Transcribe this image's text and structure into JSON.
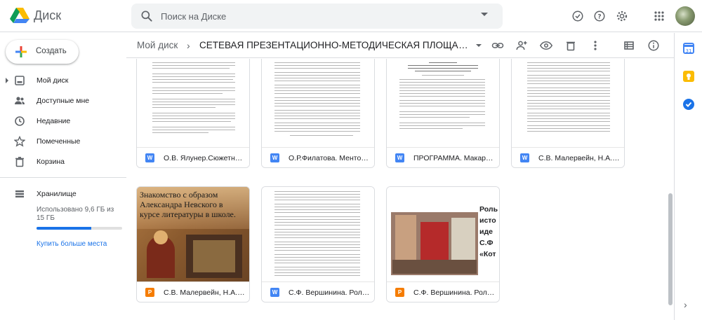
{
  "app": {
    "title": "Диск"
  },
  "search": {
    "placeholder": "Поиск на Диске"
  },
  "sidebar": {
    "new_label": "Создать",
    "items": [
      {
        "label": "Мой диск"
      },
      {
        "label": "Доступные мне"
      },
      {
        "label": "Недавние"
      },
      {
        "label": "Помеченные"
      },
      {
        "label": "Корзина"
      }
    ],
    "storage_label": "Хранилище",
    "storage_used": "Использовано 9,6 ГБ из 15 ГБ",
    "storage_fraction": 0.64,
    "buy_label": "Купить больше места"
  },
  "breadcrumb": {
    "root": "Мой диск",
    "folder": "СЕТЕВАЯ ПРЕЗЕНТАЦИОННО-МЕТОДИЧЕСКАЯ ПЛОЩАДКА ..."
  },
  "files": [
    {
      "name": "О.В. Ялунер.Сюжетно-р...",
      "type": "W"
    },
    {
      "name": "О.Р.Филатова. Менторс...",
      "type": "W"
    },
    {
      "name": "ПРОГРАММА. Макарие...",
      "type": "W"
    },
    {
      "name": "С.В. Малервейн, Н.А. Ри...",
      "type": "W"
    },
    {
      "name": "С.В. Малервейн, Н.А. Ри...",
      "type": "P",
      "thumb_text": "Знакомство с образом Александра Невского в курсе литературы в школе."
    },
    {
      "name": "С.Ф. Вершинина. Роль м...",
      "type": "W"
    },
    {
      "name": "С.Ф. Вершинина. Роль м...",
      "type": "P",
      "thumb_text": "Роль исто иде С.Ф «Кот"
    }
  ],
  "colors": {
    "word": "#4285f4",
    "slides": "#f57c00",
    "accent": "#1a73e8"
  }
}
